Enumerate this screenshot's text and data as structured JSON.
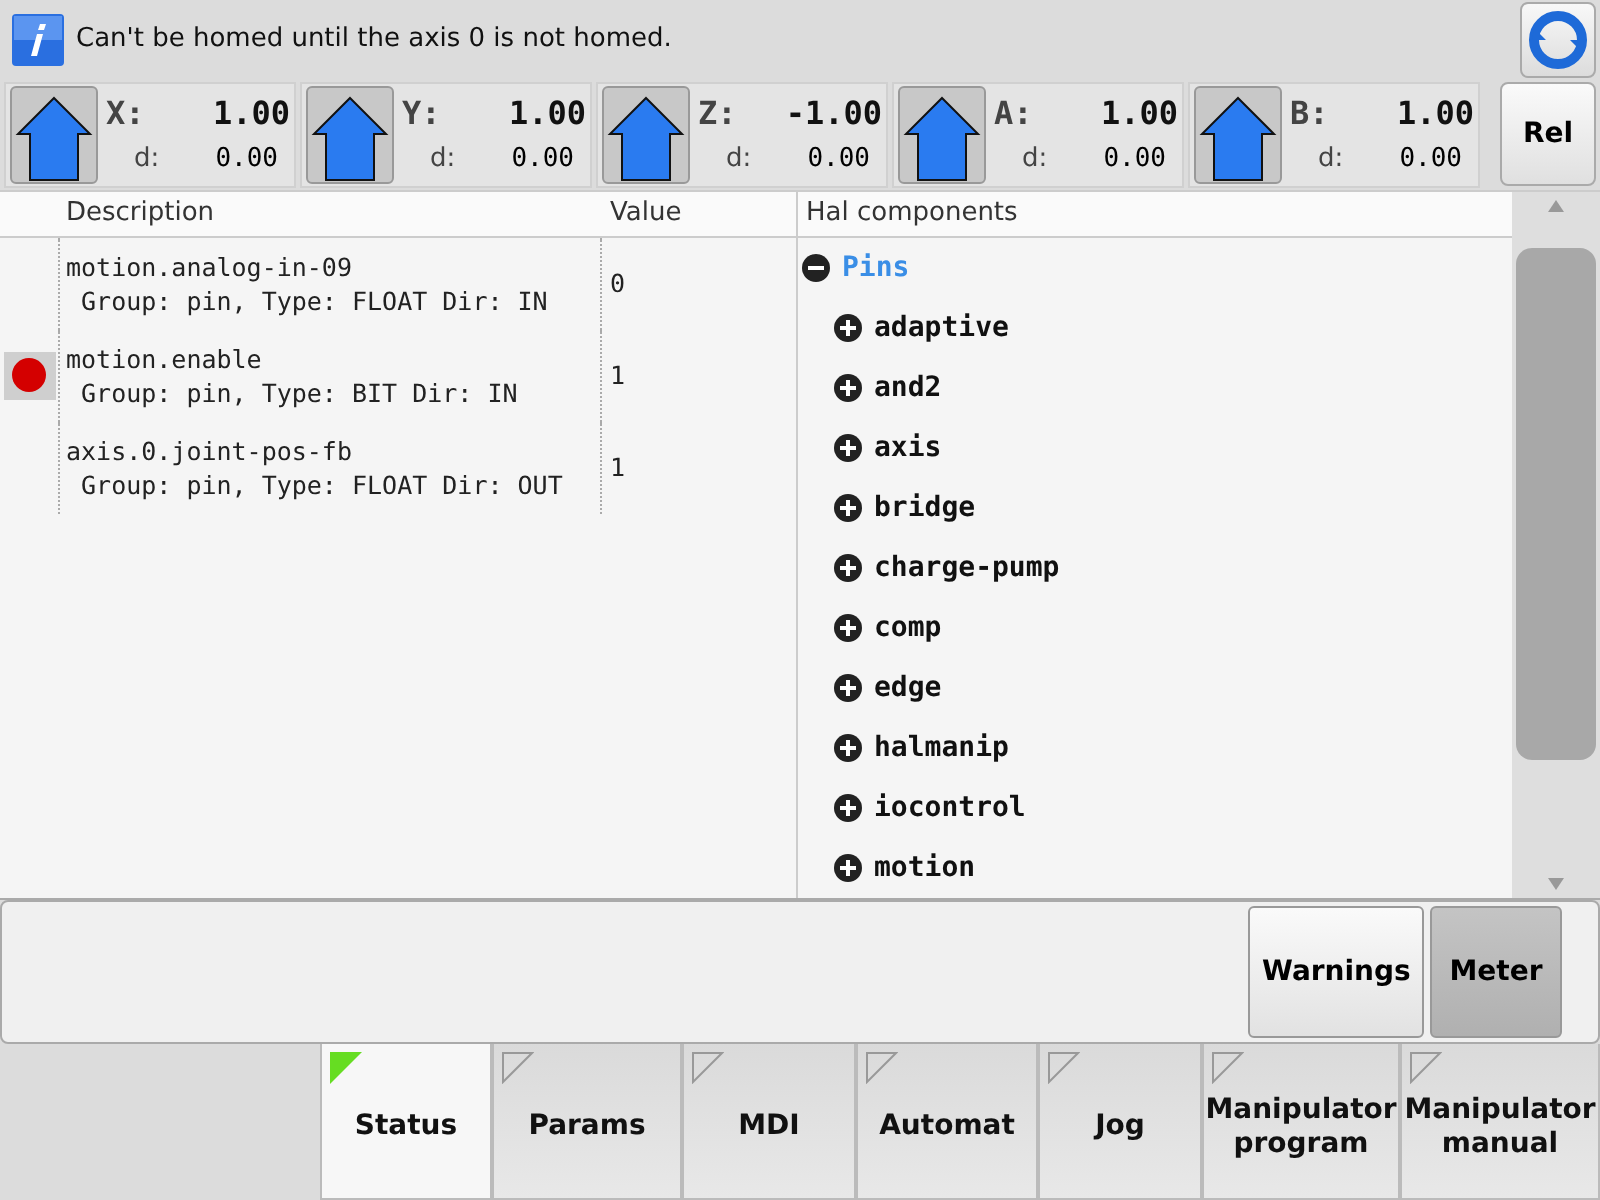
{
  "message": "Can't be homed until the axis 0 is not homed.",
  "axes": [
    {
      "label": "X:",
      "value": "1.00",
      "d_label": "d:",
      "d_value": "0.00"
    },
    {
      "label": "Y:",
      "value": "1.00",
      "d_label": "d:",
      "d_value": "0.00"
    },
    {
      "label": "Z:",
      "value": "-1.00",
      "d_label": "d:",
      "d_value": "0.00"
    },
    {
      "label": "A:",
      "value": "1.00",
      "d_label": "d:",
      "d_value": "0.00"
    },
    {
      "label": "B:",
      "value": "1.00",
      "d_label": "d:",
      "d_value": "0.00"
    }
  ],
  "rel_button": "Rel",
  "table": {
    "columns": [
      "Description",
      "Value"
    ],
    "rows": [
      {
        "name": "motion.analog-in-09",
        "details": " Group: pin, Type: FLOAT Dir: IN",
        "value": "0",
        "breakpoint": false
      },
      {
        "name": "motion.enable",
        "details": " Group: pin, Type: BIT Dir: IN",
        "value": "1",
        "breakpoint": true
      },
      {
        "name": "axis.0.joint-pos-fb",
        "details": " Group: pin, Type: FLOAT Dir: OUT",
        "value": "1",
        "breakpoint": false
      }
    ]
  },
  "tree": {
    "header": "Hal components",
    "items": [
      {
        "label": "Pins",
        "expanded": true,
        "children": [
          {
            "label": "adaptive",
            "expanded": false
          },
          {
            "label": "and2",
            "expanded": false
          },
          {
            "label": "axis",
            "expanded": false
          },
          {
            "label": "bridge",
            "expanded": false
          },
          {
            "label": "charge-pump",
            "expanded": false
          },
          {
            "label": "comp",
            "expanded": false
          },
          {
            "label": "edge",
            "expanded": false
          },
          {
            "label": "halmanip",
            "expanded": false
          },
          {
            "label": "iocontrol",
            "expanded": false
          },
          {
            "label": "motion",
            "expanded": false
          }
        ]
      }
    ]
  },
  "panel_buttons": [
    {
      "label": "Warnings",
      "selected": false
    },
    {
      "label": "Meter",
      "selected": true
    }
  ],
  "tabs": [
    {
      "label": "Status",
      "selected": true
    },
    {
      "label": "Params",
      "selected": false
    },
    {
      "label": "MDI",
      "selected": false
    },
    {
      "label": "Automat",
      "selected": false
    },
    {
      "label": "Jog",
      "selected": false
    },
    {
      "label": "Manipulator program",
      "selected": false
    },
    {
      "label": "Manipulator manual",
      "selected": false
    }
  ]
}
